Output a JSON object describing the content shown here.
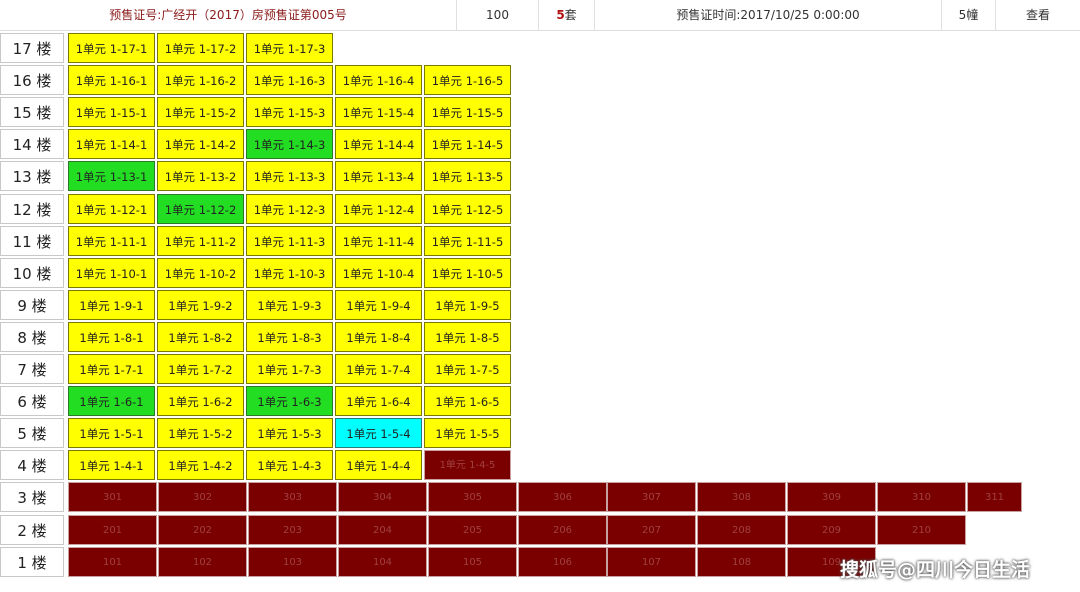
{
  "header": {
    "cert": "预售证号:广经开（2017）房预售证第005号",
    "count": "100",
    "sets_num": "5",
    "sets_unit": "套",
    "time": "预售证时间:2017/10/25 0:00:00",
    "building": "5幢",
    "view": "查看"
  },
  "floors": [
    {
      "label": "17 楼",
      "units": [
        {
          "text": "1单元 1-17-1",
          "status": "available"
        },
        {
          "text": "1单元 1-17-2",
          "status": "available"
        },
        {
          "text": "1单元 1-17-3",
          "status": "available"
        }
      ]
    },
    {
      "label": "16 楼",
      "units": [
        {
          "text": "1单元 1-16-1",
          "status": "available"
        },
        {
          "text": "1单元 1-16-2",
          "status": "available"
        },
        {
          "text": "1单元 1-16-3",
          "status": "available"
        },
        {
          "text": "1单元 1-16-4",
          "status": "available"
        },
        {
          "text": "1单元 1-16-5",
          "status": "available"
        }
      ]
    },
    {
      "label": "15 楼",
      "units": [
        {
          "text": "1单元 1-15-1",
          "status": "available"
        },
        {
          "text": "1单元 1-15-2",
          "status": "available"
        },
        {
          "text": "1单元 1-15-3",
          "status": "available"
        },
        {
          "text": "1单元 1-15-4",
          "status": "available"
        },
        {
          "text": "1单元 1-15-5",
          "status": "available"
        }
      ]
    },
    {
      "label": "14 楼",
      "units": [
        {
          "text": "1单元 1-14-1",
          "status": "available"
        },
        {
          "text": "1单元 1-14-2",
          "status": "available"
        },
        {
          "text": "1单元 1-14-3",
          "status": "green"
        },
        {
          "text": "1单元 1-14-4",
          "status": "available"
        },
        {
          "text": "1单元 1-14-5",
          "status": "available"
        }
      ]
    },
    {
      "label": "13 楼",
      "units": [
        {
          "text": "1单元 1-13-1",
          "status": "green"
        },
        {
          "text": "1单元 1-13-2",
          "status": "available"
        },
        {
          "text": "1单元 1-13-3",
          "status": "available"
        },
        {
          "text": "1单元 1-13-4",
          "status": "available"
        },
        {
          "text": "1单元 1-13-5",
          "status": "available"
        }
      ]
    },
    {
      "label": "12 楼",
      "units": [
        {
          "text": "1单元 1-12-1",
          "status": "available"
        },
        {
          "text": "1单元 1-12-2",
          "status": "green"
        },
        {
          "text": "1单元 1-12-3",
          "status": "available"
        },
        {
          "text": "1单元 1-12-4",
          "status": "available"
        },
        {
          "text": "1单元 1-12-5",
          "status": "available"
        }
      ]
    },
    {
      "label": "11 楼",
      "units": [
        {
          "text": "1单元 1-11-1",
          "status": "available"
        },
        {
          "text": "1单元 1-11-2",
          "status": "available"
        },
        {
          "text": "1单元 1-11-3",
          "status": "available"
        },
        {
          "text": "1单元 1-11-4",
          "status": "available"
        },
        {
          "text": "1单元 1-11-5",
          "status": "available"
        }
      ]
    },
    {
      "label": "10 楼",
      "units": [
        {
          "text": "1单元 1-10-1",
          "status": "available"
        },
        {
          "text": "1单元 1-10-2",
          "status": "available"
        },
        {
          "text": "1单元 1-10-3",
          "status": "available"
        },
        {
          "text": "1单元 1-10-4",
          "status": "available"
        },
        {
          "text": "1单元 1-10-5",
          "status": "available"
        }
      ]
    },
    {
      "label": "9 楼",
      "units": [
        {
          "text": "1单元 1-9-1",
          "status": "available"
        },
        {
          "text": "1单元 1-9-2",
          "status": "available"
        },
        {
          "text": "1单元 1-9-3",
          "status": "available"
        },
        {
          "text": "1单元 1-9-4",
          "status": "available"
        },
        {
          "text": "1单元 1-9-5",
          "status": "available"
        }
      ]
    },
    {
      "label": "8 楼",
      "units": [
        {
          "text": "1单元 1-8-1",
          "status": "available"
        },
        {
          "text": "1单元 1-8-2",
          "status": "available"
        },
        {
          "text": "1单元 1-8-3",
          "status": "available"
        },
        {
          "text": "1单元 1-8-4",
          "status": "available"
        },
        {
          "text": "1单元 1-8-5",
          "status": "available"
        }
      ]
    },
    {
      "label": "7 楼",
      "units": [
        {
          "text": "1单元 1-7-1",
          "status": "available"
        },
        {
          "text": "1单元 1-7-2",
          "status": "available"
        },
        {
          "text": "1单元 1-7-3",
          "status": "available"
        },
        {
          "text": "1单元 1-7-4",
          "status": "available"
        },
        {
          "text": "1单元 1-7-5",
          "status": "available"
        }
      ]
    },
    {
      "label": "6 楼",
      "units": [
        {
          "text": "1单元 1-6-1",
          "status": "green"
        },
        {
          "text": "1单元 1-6-2",
          "status": "available"
        },
        {
          "text": "1单元 1-6-3",
          "status": "green"
        },
        {
          "text": "1单元 1-6-4",
          "status": "available"
        },
        {
          "text": "1单元 1-6-5",
          "status": "available"
        }
      ]
    },
    {
      "label": "5 楼",
      "units": [
        {
          "text": "1单元 1-5-1",
          "status": "available"
        },
        {
          "text": "1单元 1-5-2",
          "status": "available"
        },
        {
          "text": "1单元 1-5-3",
          "status": "available"
        },
        {
          "text": "1单元 1-5-4",
          "status": "cyan"
        },
        {
          "text": "1单元 1-5-5",
          "status": "available"
        }
      ]
    },
    {
      "label": "4 楼",
      "units": [
        {
          "text": "1单元 1-4-1",
          "status": "available"
        },
        {
          "text": "1单元 1-4-2",
          "status": "available"
        },
        {
          "text": "1单元 1-4-3",
          "status": "available"
        },
        {
          "text": "1单元 1-4-4",
          "status": "available"
        },
        {
          "text": "1单元 1-4-5",
          "status": "sold"
        }
      ]
    },
    {
      "label": "3 楼",
      "units": [
        {
          "text": "301",
          "status": "sold"
        },
        {
          "text": "302",
          "status": "sold"
        },
        {
          "text": "303",
          "status": "sold"
        },
        {
          "text": "304",
          "status": "sold"
        },
        {
          "text": "305",
          "status": "sold"
        },
        {
          "text": "306",
          "status": "sold"
        },
        {
          "text": "307",
          "status": "sold"
        },
        {
          "text": "308",
          "status": "sold"
        },
        {
          "text": "309",
          "status": "sold"
        },
        {
          "text": "310",
          "status": "sold"
        },
        {
          "text": "311",
          "status": "sold"
        }
      ]
    },
    {
      "label": "2 楼",
      "units": [
        {
          "text": "201",
          "status": "sold"
        },
        {
          "text": "202",
          "status": "sold"
        },
        {
          "text": "203",
          "status": "sold"
        },
        {
          "text": "204",
          "status": "sold"
        },
        {
          "text": "205",
          "status": "sold"
        },
        {
          "text": "206",
          "status": "sold"
        },
        {
          "text": "207",
          "status": "sold"
        },
        {
          "text": "208",
          "status": "sold"
        },
        {
          "text": "209",
          "status": "sold"
        },
        {
          "text": "210",
          "status": "sold"
        }
      ]
    },
    {
      "label": "1 楼",
      "units": [
        {
          "text": "101",
          "status": "sold"
        },
        {
          "text": "102",
          "status": "sold"
        },
        {
          "text": "103",
          "status": "sold"
        },
        {
          "text": "104",
          "status": "sold"
        },
        {
          "text": "105",
          "status": "sold"
        },
        {
          "text": "106",
          "status": "sold"
        },
        {
          "text": "107",
          "status": "sold"
        },
        {
          "text": "108",
          "status": "sold"
        },
        {
          "text": "109",
          "status": "sold"
        }
      ]
    }
  ],
  "colors": {
    "available": "#ffff00",
    "green": "#22dd22",
    "cyan": "#00ffff",
    "sold": "#7a0000"
  },
  "watermark": "搜狐号@四川今日生活"
}
